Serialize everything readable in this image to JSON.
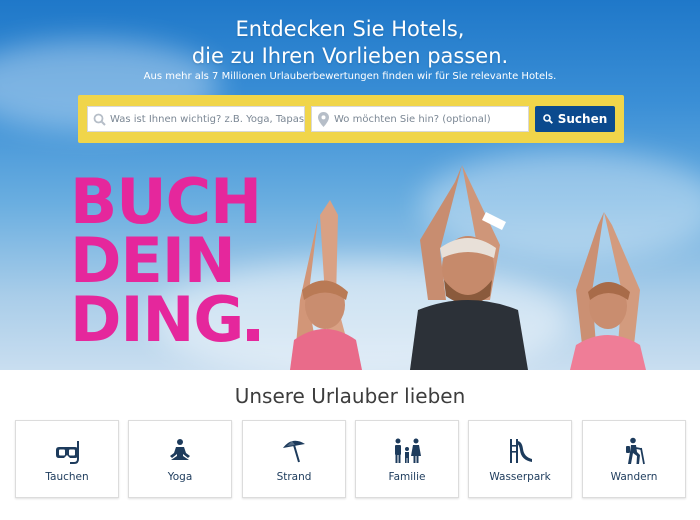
{
  "hero": {
    "title_line1": "Entdecken Sie Hotels,",
    "title_line2": "die zu Ihren Vorlieben passen.",
    "subtitle": "Aus mehr als 7 Millionen Urlauberbewertungen finden wir für Sie relevante Hotels.",
    "slogan_line1": "BUCH",
    "slogan_line2": "DEIN",
    "slogan_line3": "DING"
  },
  "search": {
    "what_placeholder": "Was ist Ihnen wichtig? z.B. Yoga, Tapas",
    "where_placeholder": "Wo möchten Sie hin? (optional)",
    "button_label": "Suchen",
    "what_icon": "search-icon",
    "where_icon": "map-pin-icon"
  },
  "section": {
    "title": "Unsere Urlauber lieben"
  },
  "categories": [
    {
      "label": "Tauchen",
      "icon": "diving-mask-icon"
    },
    {
      "label": "Yoga",
      "icon": "yoga-icon"
    },
    {
      "label": "Strand",
      "icon": "beach-umbrella-icon"
    },
    {
      "label": "Familie",
      "icon": "family-icon"
    },
    {
      "label": "Wasserpark",
      "icon": "water-slide-icon"
    },
    {
      "label": "Wandern",
      "icon": "hiking-icon"
    }
  ],
  "colors": {
    "accent_yellow": "#f0d54a",
    "button_blue": "#0b4a8e",
    "slogan_pink": "#e5279c",
    "icon_navy": "#1d3b5c"
  }
}
